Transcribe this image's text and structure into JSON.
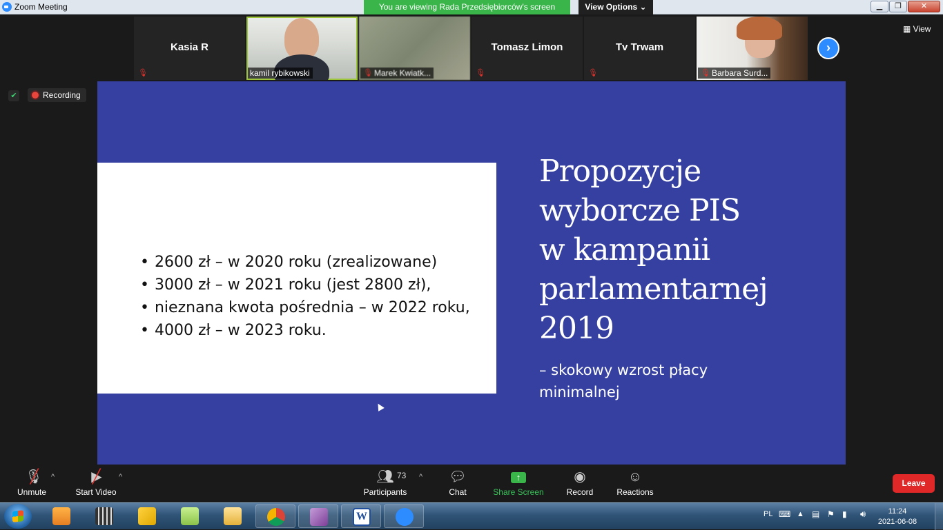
{
  "window": {
    "title": "Zoom Meeting",
    "viewing_banner": "You are viewing Rada Przedsiębiorców's screen",
    "view_options": "View Options ⌄",
    "min": "▁",
    "max": "❐",
    "close": "✕"
  },
  "participants_strip": [
    {
      "name": "Kasia R",
      "video": false
    },
    {
      "name": "kamil rybikowski",
      "video": true
    },
    {
      "name": "Marek Kwiatk...",
      "video": true
    },
    {
      "name": "Tomasz Limon",
      "video": false
    },
    {
      "name": "Tv Trwam",
      "video": false
    },
    {
      "name": "Barbara Surd...",
      "video": true
    }
  ],
  "view_button": "View",
  "recording_label": "Recording",
  "slide": {
    "bullets": [
      "2600 zł – w 2020 roku (zrealizowane)",
      "3000 zł – w 2021 roku (jest 2800 zł),",
      "nieznana kwota pośrednia – w 2022 roku,",
      "4000 zł – w 2023 roku."
    ],
    "heading": [
      "Propozycje",
      "wyborcze PIS",
      "w kampanii",
      "parlamentarnej",
      "2019"
    ],
    "subheading": [
      "– skokowy wzrost płacy",
      "minimalnej"
    ]
  },
  "toolbar": {
    "unmute": "Unmute",
    "start_video": "Start Video",
    "participants": "Participants",
    "participants_count": "73",
    "chat": "Chat",
    "share_screen": "Share Screen",
    "record": "Record",
    "reactions": "Reactions",
    "leave": "Leave"
  },
  "taskbar": {
    "language": "PL",
    "time": "11:24",
    "date": "2021-06-08"
  },
  "colors": {
    "slide_blue": "#3540a0",
    "share_green": "#39b54a",
    "leave_red": "#e02828",
    "zoom_blue": "#2d8cff"
  }
}
